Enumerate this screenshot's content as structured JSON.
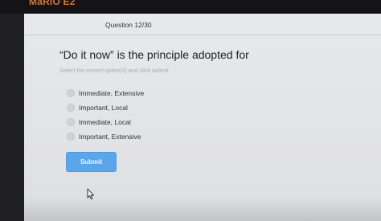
{
  "app": {
    "brand": "MaRIO E2"
  },
  "quiz": {
    "counter": "Question 12/30",
    "question": "“Do it now” is the principle adopted for",
    "instruction": "Select the correct option(s) and click submit.",
    "options": [
      {
        "label": "Immediate, Extensive"
      },
      {
        "label": "Important, Local"
      },
      {
        "label": "Immediate, Local"
      },
      {
        "label": "Important, Extensive"
      }
    ],
    "submit_label": "Submit"
  },
  "colors": {
    "brand": "#d8743a",
    "accent": "#5aa6e8"
  },
  "icons": {
    "cursor": "mouse-pointer-icon"
  }
}
